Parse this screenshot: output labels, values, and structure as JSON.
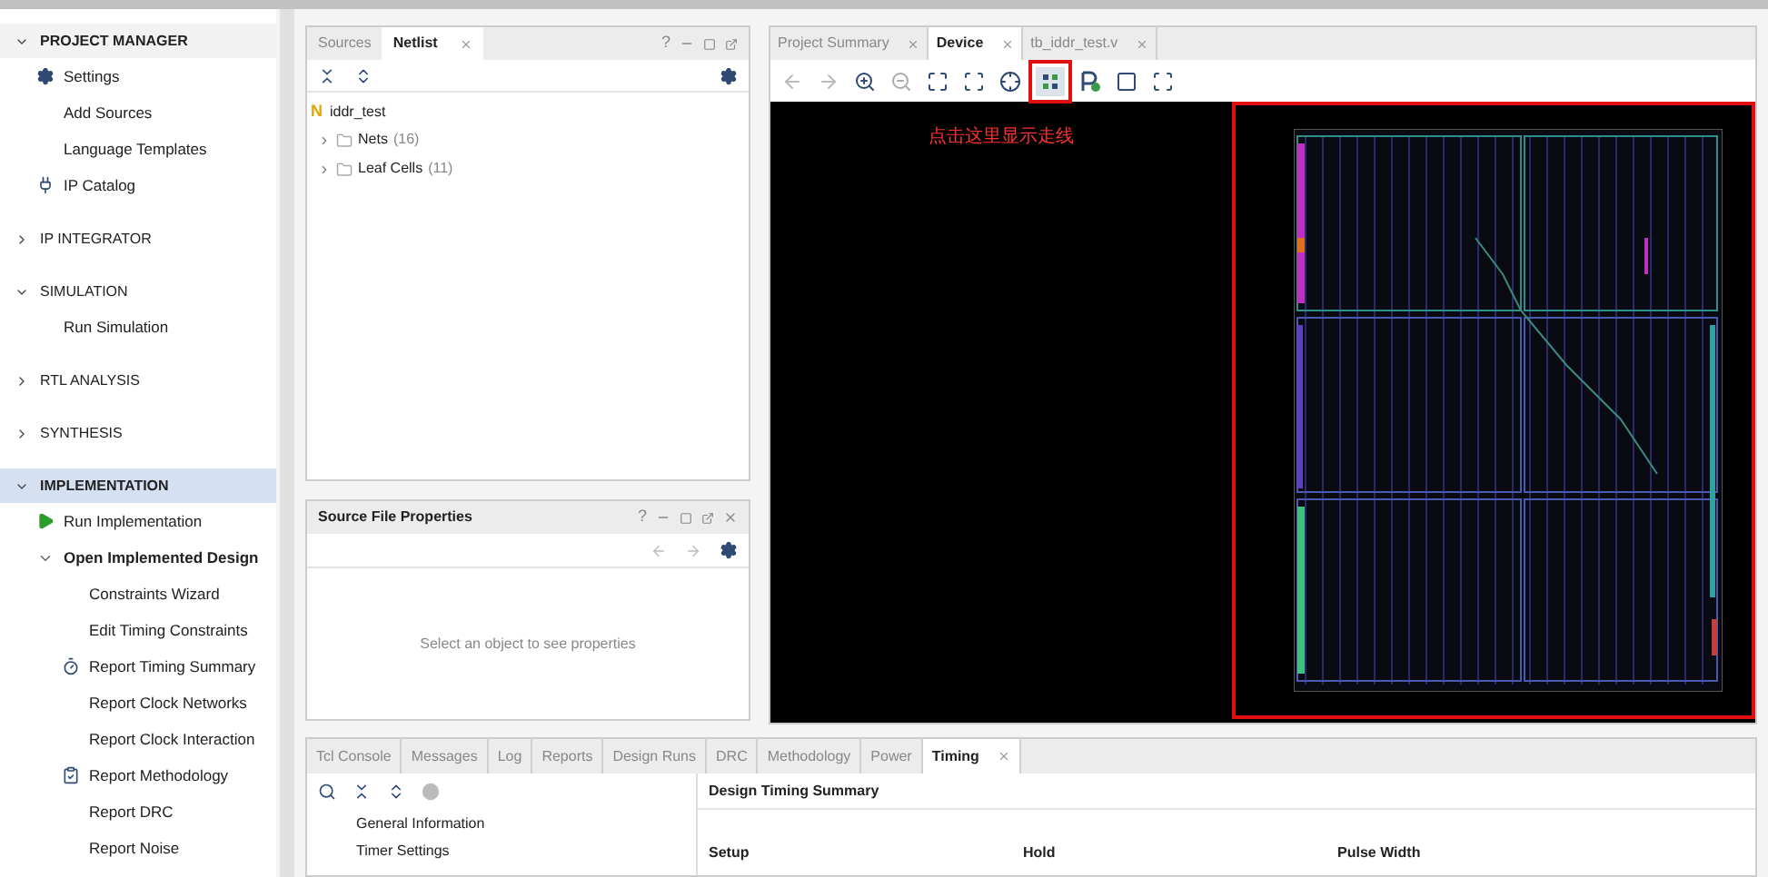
{
  "flow_navigator": {
    "sections": [
      {
        "title": "PROJECT MANAGER",
        "expanded": true,
        "selected": false,
        "items": [
          {
            "label": "Settings",
            "kind": "gear"
          },
          {
            "label": "Add Sources"
          },
          {
            "label": "Language Templates"
          },
          {
            "label": "IP Catalog",
            "kind": "plug"
          }
        ]
      },
      {
        "title": "IP INTEGRATOR",
        "expanded": false,
        "selected": false
      },
      {
        "title": "SIMULATION",
        "expanded": true,
        "selected": false,
        "items": [
          {
            "label": "Run Simulation"
          }
        ]
      },
      {
        "title": "RTL ANALYSIS",
        "expanded": false,
        "selected": false
      },
      {
        "title": "SYNTHESIS",
        "expanded": false,
        "selected": false
      },
      {
        "title": "IMPLEMENTATION",
        "expanded": true,
        "selected": true,
        "items": [
          {
            "label": "Run Implementation",
            "kind": "play"
          },
          {
            "label": "Open Implemented Design",
            "expanded": true,
            "children": [
              {
                "label": "Constraints Wizard"
              },
              {
                "label": "Edit Timing Constraints"
              },
              {
                "label": "Report Timing Summary",
                "kind": "timer"
              },
              {
                "label": "Report Clock Networks"
              },
              {
                "label": "Report Clock Interaction"
              },
              {
                "label": "Report Methodology",
                "kind": "clipboard"
              },
              {
                "label": "Report DRC"
              },
              {
                "label": "Report Noise"
              }
            ]
          }
        ]
      }
    ]
  },
  "netlist_panel": {
    "tabs": [
      {
        "label": "Sources",
        "selected": false
      },
      {
        "label": "Netlist",
        "selected": true
      }
    ],
    "window_buttons": [
      "?"
    ],
    "tree": {
      "label": "iddr_test",
      "badge": "N",
      "children": [
        {
          "label": "Nets",
          "count": "(16)",
          "expanded": false
        },
        {
          "label": "Leaf Cells",
          "count": "(11)",
          "expanded": false
        }
      ]
    }
  },
  "properties_panel": {
    "title": "Source File Properties",
    "window_buttons": [
      "?"
    ],
    "empty_message": "Select an object to see properties"
  },
  "device_panel": {
    "tabs": [
      {
        "label": "Project Summary",
        "selected": false
      },
      {
        "label": "Device",
        "selected": true
      },
      {
        "label": "tb_iddr_test.v",
        "selected": false
      }
    ],
    "annotation": "点击这里显示走线"
  },
  "bottom_panel": {
    "tabs": [
      {
        "label": "Tcl Console",
        "selected": false
      },
      {
        "label": "Messages",
        "selected": false
      },
      {
        "label": "Log",
        "selected": false
      },
      {
        "label": "Reports",
        "selected": false
      },
      {
        "label": "Design Runs",
        "selected": false
      },
      {
        "label": "DRC",
        "selected": false
      },
      {
        "label": "Methodology",
        "selected": false
      },
      {
        "label": "Power",
        "selected": false
      },
      {
        "label": "Timing",
        "selected": true
      }
    ],
    "timing_tree": [
      "General Information",
      "Timer Settings"
    ],
    "summary_title": "Design Timing Summary",
    "columns": [
      "Setup",
      "Hold",
      "Pulse Width"
    ]
  }
}
